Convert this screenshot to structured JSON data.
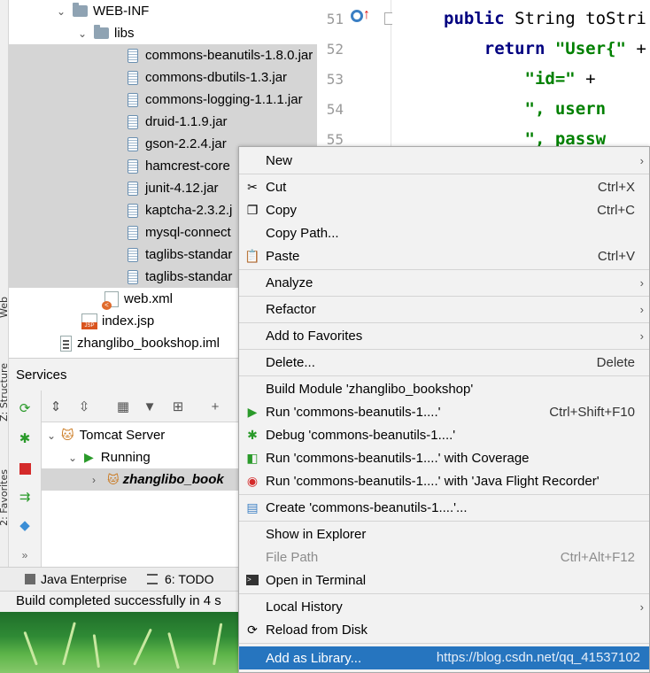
{
  "tree": {
    "items": [
      {
        "label": "WEB-INF",
        "kind": "folder"
      },
      {
        "label": "libs",
        "kind": "folder"
      },
      {
        "label": "commons-beanutils-1.8.0.jar",
        "kind": "jar"
      },
      {
        "label": "commons-dbutils-1.3.jar",
        "kind": "jar"
      },
      {
        "label": "commons-logging-1.1.1.jar",
        "kind": "jar"
      },
      {
        "label": "druid-1.1.9.jar",
        "kind": "jar"
      },
      {
        "label": "gson-2.2.4.jar",
        "kind": "jar"
      },
      {
        "label": "hamcrest-core",
        "kind": "jar"
      },
      {
        "label": "junit-4.12.jar",
        "kind": "jar"
      },
      {
        "label": "kaptcha-2.3.2.j",
        "kind": "jar"
      },
      {
        "label": "mysql-connect",
        "kind": "jar"
      },
      {
        "label": "taglibs-standar",
        "kind": "jar"
      },
      {
        "label": "taglibs-standar",
        "kind": "jar"
      },
      {
        "label": "web.xml",
        "kind": "xml"
      },
      {
        "label": "index.jsp",
        "kind": "jsp"
      },
      {
        "label": "zhanglibo_bookshop.iml",
        "kind": "iml"
      }
    ]
  },
  "side_tabs": {
    "web": "Web",
    "structure": "Z: Structure",
    "favorites": "2: Favorites"
  },
  "editor": {
    "line_numbers": [
      "51",
      "52",
      "53",
      "54",
      "55"
    ],
    "lines": [
      [
        {
          "t": "public ",
          "c": "kw"
        },
        {
          "t": "String toStri",
          "c": ""
        }
      ],
      [
        {
          "t": "    return ",
          "c": "kw"
        },
        {
          "t": "\"User{\"",
          "c": "str"
        },
        {
          "t": " +",
          "c": ""
        }
      ],
      [
        {
          "t": "        ",
          "c": ""
        },
        {
          "t": "\"id=\"",
          "c": "str"
        },
        {
          "t": " +",
          "c": ""
        }
      ],
      [
        {
          "t": "        ",
          "c": ""
        },
        {
          "t": "\", usern",
          "c": "str"
        }
      ],
      [
        {
          "t": "        ",
          "c": ""
        },
        {
          "t": "\", passw",
          "c": "str"
        }
      ]
    ]
  },
  "services": {
    "title": "Services",
    "tomcat": "Tomcat Server",
    "running": "Running",
    "app": "zhanglibo_book"
  },
  "bottom_tabs": {
    "java_ee": "Java Enterprise",
    "todo": "6: TODO"
  },
  "status": "Build completed successfully in 4 s",
  "menu": {
    "items": [
      {
        "label": "New",
        "shortcut": "",
        "submenu": true,
        "icon": "",
        "disabled": false,
        "highlighted": false
      },
      {
        "label": "Cut",
        "shortcut": "Ctrl+X",
        "submenu": false,
        "icon": "scissors-icon",
        "disabled": false,
        "highlighted": false
      },
      {
        "label": "Copy",
        "shortcut": "Ctrl+C",
        "submenu": false,
        "icon": "copy-icon",
        "disabled": false,
        "highlighted": false
      },
      {
        "label": "Copy Path...",
        "shortcut": "",
        "submenu": false,
        "icon": "",
        "disabled": false,
        "highlighted": false
      },
      {
        "label": "Paste",
        "shortcut": "Ctrl+V",
        "submenu": false,
        "icon": "paste-icon",
        "disabled": false,
        "highlighted": false
      },
      {
        "label": "Analyze",
        "shortcut": "",
        "submenu": true,
        "icon": "",
        "disabled": false,
        "highlighted": false
      },
      {
        "label": "Refactor",
        "shortcut": "",
        "submenu": true,
        "icon": "",
        "disabled": false,
        "highlighted": false
      },
      {
        "label": "Add to Favorites",
        "shortcut": "",
        "submenu": true,
        "icon": "",
        "disabled": false,
        "highlighted": false
      },
      {
        "label": "Delete...",
        "shortcut": "Delete",
        "submenu": false,
        "icon": "",
        "disabled": false,
        "highlighted": false
      },
      {
        "label": "Build Module 'zhanglibo_bookshop'",
        "shortcut": "",
        "submenu": false,
        "icon": "",
        "disabled": false,
        "highlighted": false
      },
      {
        "label": "Run 'commons-beanutils-1....'",
        "shortcut": "Ctrl+Shift+F10",
        "submenu": false,
        "icon": "run-icon",
        "disabled": false,
        "highlighted": false
      },
      {
        "label": "Debug 'commons-beanutils-1....'",
        "shortcut": "",
        "submenu": false,
        "icon": "debug-icon",
        "disabled": false,
        "highlighted": false
      },
      {
        "label": "Run 'commons-beanutils-1....' with Coverage",
        "shortcut": "",
        "submenu": false,
        "icon": "coverage-icon",
        "disabled": false,
        "highlighted": false
      },
      {
        "label": "Run 'commons-beanutils-1....' with 'Java Flight Recorder'",
        "shortcut": "",
        "submenu": false,
        "icon": "flight-recorder-icon",
        "disabled": false,
        "highlighted": false
      },
      {
        "label": "Create 'commons-beanutils-1....'...",
        "shortcut": "",
        "submenu": false,
        "icon": "create-config-icon",
        "disabled": false,
        "highlighted": false
      },
      {
        "label": "Show in Explorer",
        "shortcut": "",
        "submenu": false,
        "icon": "",
        "disabled": false,
        "highlighted": false
      },
      {
        "label": "File Path",
        "shortcut": "Ctrl+Alt+F12",
        "submenu": false,
        "icon": "",
        "disabled": true,
        "highlighted": false
      },
      {
        "label": "Open in Terminal",
        "shortcut": "",
        "submenu": false,
        "icon": "terminal-icon",
        "disabled": false,
        "highlighted": false
      },
      {
        "label": "Local History",
        "shortcut": "",
        "submenu": true,
        "icon": "",
        "disabled": false,
        "highlighted": false
      },
      {
        "label": "Reload from Disk",
        "shortcut": "",
        "submenu": false,
        "icon": "reload-icon",
        "disabled": false,
        "highlighted": false
      },
      {
        "label": "Add as Library...",
        "shortcut": "",
        "submenu": false,
        "icon": "",
        "disabled": false,
        "highlighted": true
      }
    ],
    "watermark": "https://blog.csdn.net/qq_41537102"
  },
  "colors": {
    "highlight": "#2675bf",
    "selection": "#d5d5d5",
    "keyword": "#000080",
    "string": "#008000"
  }
}
